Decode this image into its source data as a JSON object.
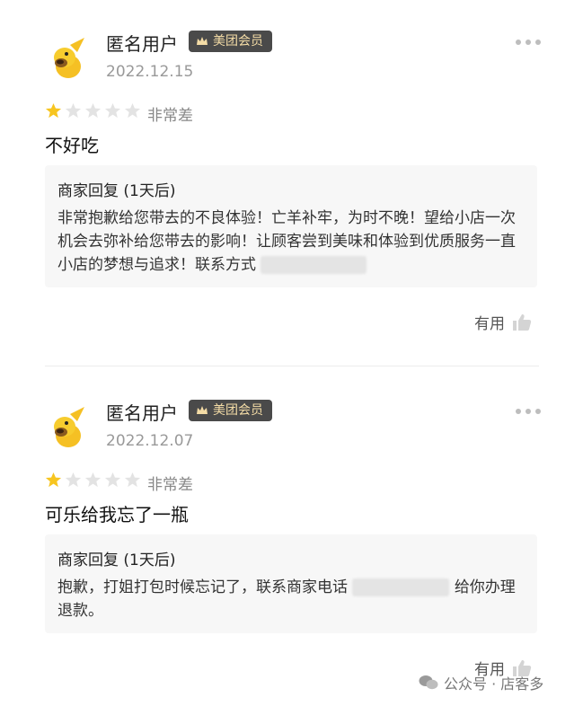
{
  "reviews": [
    {
      "user_name": "匿名用户",
      "member_badge": "美团会员",
      "date": "2022.12.15",
      "rating": 1,
      "rating_max": 5,
      "rating_text": "非常差",
      "comment": "不好吃",
      "reply_title": "商家回复 (1天后)",
      "reply_text": "非常抱歉给您带去的不良体验！亡羊补牢，为时不晚！望给小店一次机会去弥补给您带去的影响！让顾客尝到美味和体验到优质服务一直小店的梦想与追求！联系方式",
      "useful_label": "有用"
    },
    {
      "user_name": "匿名用户",
      "member_badge": "美团会员",
      "date": "2022.12.07",
      "rating": 1,
      "rating_max": 5,
      "rating_text": "非常差",
      "comment": "可乐给我忘了一瓶",
      "reply_title": "商家回复 (1天后)",
      "reply_text_before": "抱歉，打姐打包时候忘记了，联系商家电话",
      "reply_text_after": "给你办理退款。",
      "useful_label": "有用"
    }
  ],
  "watermark": "公众号 · 店客多",
  "colors": {
    "star_filled": "#f7c520",
    "star_empty": "#e3e3e3",
    "badge_bg": "#4a4a4a",
    "badge_text": "#f4dca6",
    "reply_bg": "#f7f7f7"
  }
}
